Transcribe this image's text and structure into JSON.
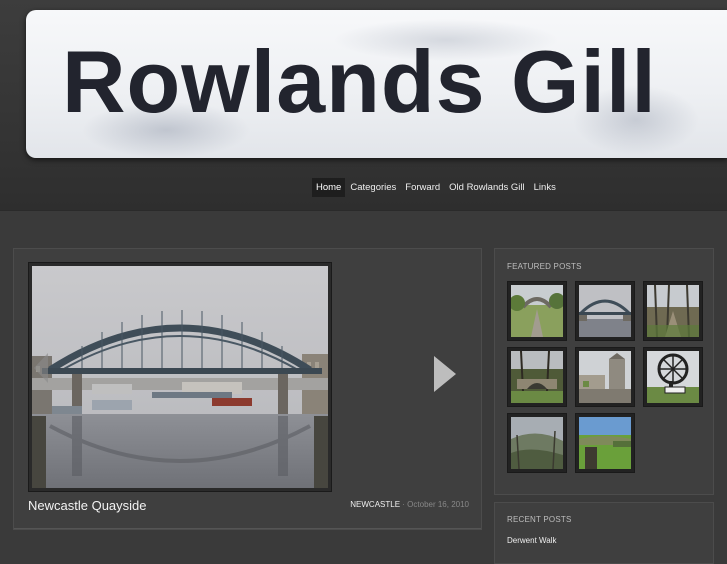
{
  "header": {
    "sign_text": "Rowlands Gill",
    "nav": [
      {
        "label": "Home",
        "active": true
      },
      {
        "label": "Categories"
      },
      {
        "label": "Forward"
      },
      {
        "label": "Old Rowlands Gill"
      },
      {
        "label": "Links"
      }
    ]
  },
  "slider": {
    "title": "Newcastle Quayside",
    "category": "NEWCASTLE",
    "date": " · October 16, 2010",
    "prev_icon": "chevron-left-icon",
    "next_icon": "chevron-right-icon"
  },
  "sidebar": {
    "featured_heading": "FEATURED POSTS",
    "recent_heading": "RECENT POSTS",
    "recent_posts": [
      "Derwent Walk"
    ]
  },
  "colors": {
    "background": "#3a3a3a",
    "panel": "#3f3f3f",
    "sign_text": "#22242e",
    "nav_active": "#1e1e1e"
  }
}
